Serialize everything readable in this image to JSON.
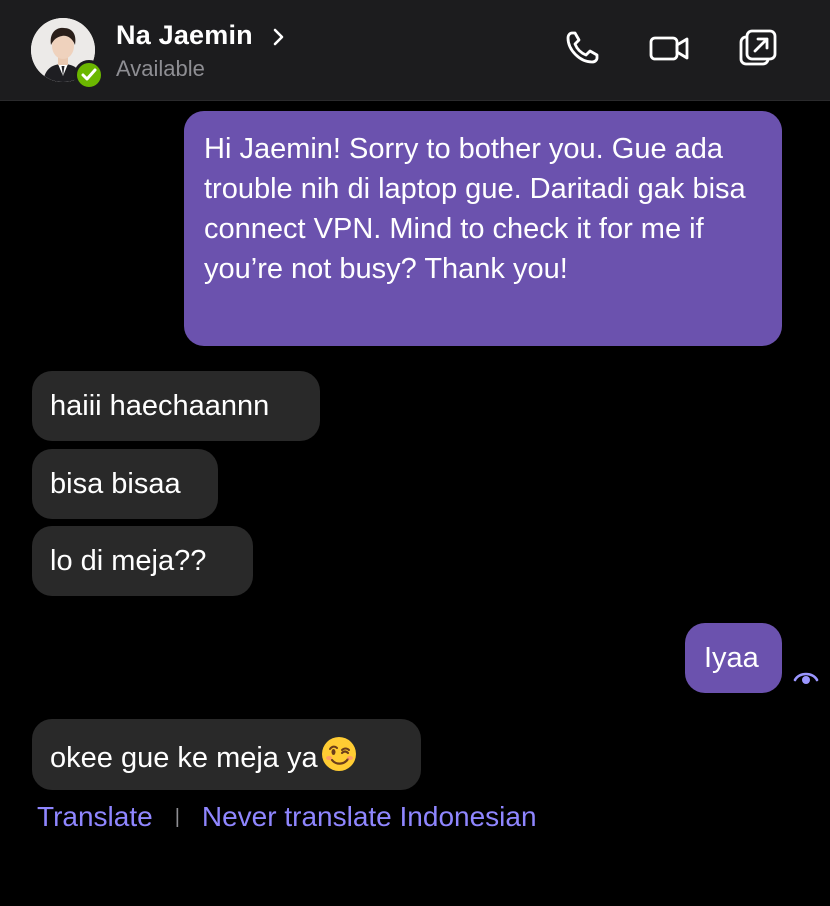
{
  "header": {
    "contact_name": "Na Jaemin",
    "status": "Available",
    "icons": [
      "phone-icon",
      "video-icon",
      "pop-out-icon"
    ]
  },
  "messages": [
    {
      "direction": "sent",
      "text": "Hi Jaemin! Sorry to bother you. Gue ada trouble nih di laptop gue. Daritadi gak bisa connect VPN. Mind to check it for me if you’re not busy? Thank you!"
    },
    {
      "direction": "received",
      "text": "haiii haechaannn"
    },
    {
      "direction": "received",
      "text": "bisa bisaa"
    },
    {
      "direction": "received",
      "text": "lo di meja??"
    },
    {
      "direction": "sent",
      "text": "Iyaa"
    },
    {
      "direction": "received",
      "text": "okee gue ke meja ya",
      "emoji": "winking-face"
    }
  ],
  "translate": {
    "translate_label": "Translate",
    "separator": "|",
    "never_label": "Never translate Indonesian"
  },
  "colors": {
    "header_bg": "#1c1c1e",
    "sent_bubble": "#6b52ae",
    "received_bubble": "#292929",
    "link": "#8f86ff",
    "status_green": "#6bb700",
    "muted_text": "#8e8e93"
  }
}
